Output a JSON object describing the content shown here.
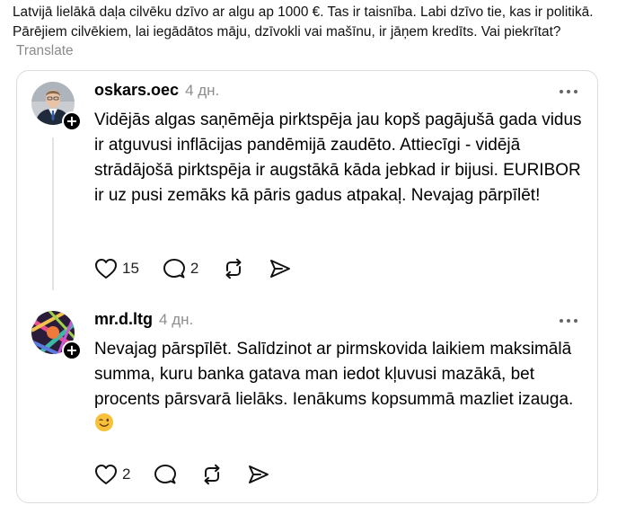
{
  "intro": {
    "text": "Latvijā lielākā daļa cilvēku dzīvo ar algu ap 1000 €. Tas ir taisnība. Labi dzīvo tie, kas ir politikā. Pārējiem cilvēkiem, lai iegādātos māju, dzīvokli vai mašīnu, ir jāņem kredīts. Vai piekrītat?",
    "translate_label": "Translate"
  },
  "posts": [
    {
      "username": "oskars.oec",
      "time": "4 дн.",
      "text": "Vidējās algas saņēmēja pirktspēja jau kopš pagājušā gada vidus ir atguvusi inflācijas pandēmijā zaudēto. Attiecīgi - vidējā strādājošā pirktspēja ir augstākā kāda jebkad ir bijusi. EURIBOR ir uz pusi zemāks kā pāris gadus atpakaļ. Nevajag pārpīlēt!",
      "likes": "15",
      "replies": "2"
    },
    {
      "username": "mr.d.ltg",
      "time": "4 дн.",
      "text": "Nevajag pārspīlēt. Salīdzinot ar pirmskovida laikiem maksimālā summa, kuru banka gatava man iedot kļuvusi mazākā, bet procents pārsvarā lielāks. Ienākums kopsummā mazliet izauga.",
      "emoji": "😉",
      "likes": "2"
    }
  ],
  "icons": {
    "like": "heart-icon",
    "reply": "comment-icon",
    "repost": "repost-icon",
    "share": "send-icon",
    "more": "more-dots-icon",
    "follow": "plus-icon"
  }
}
